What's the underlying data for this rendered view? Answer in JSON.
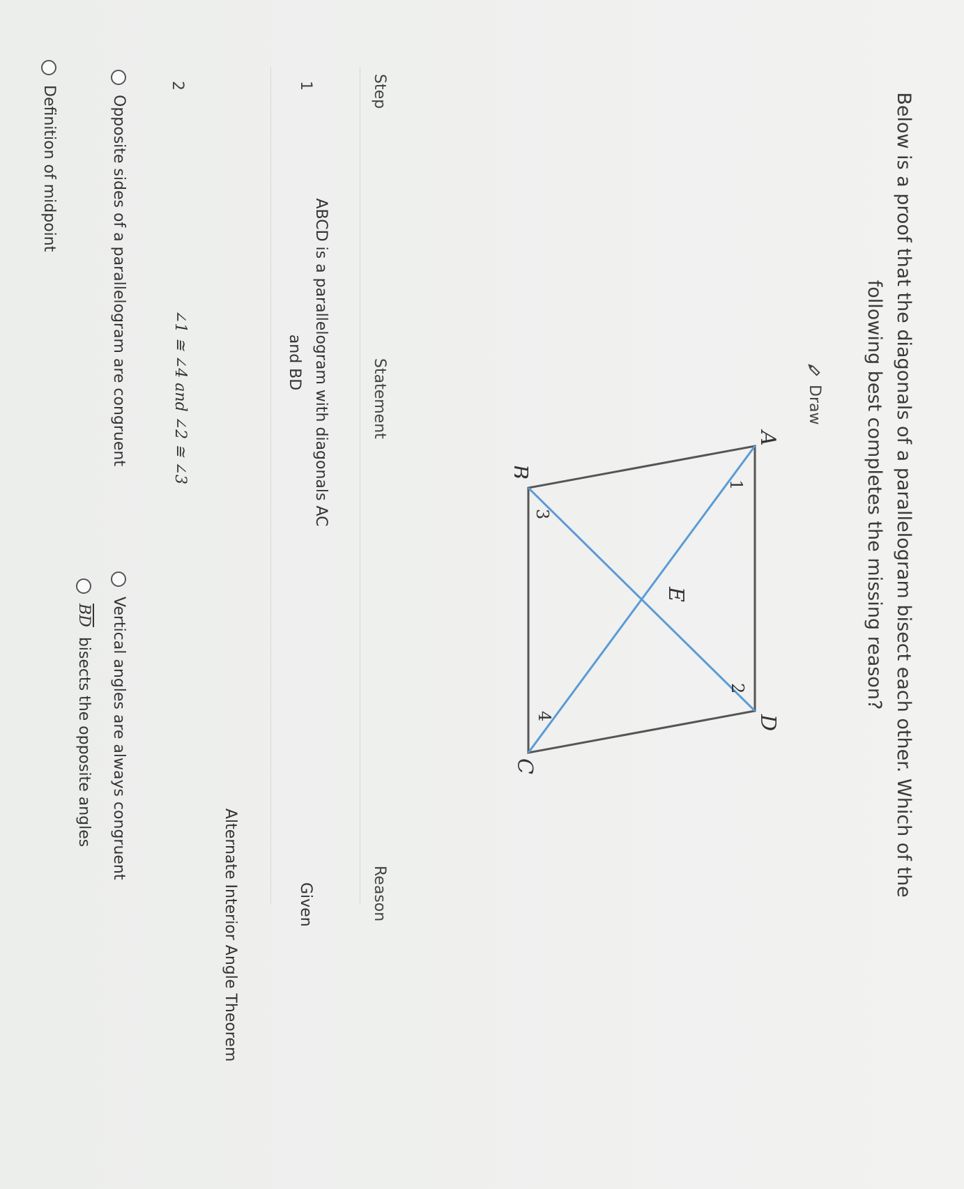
{
  "question": "Below is a proof that the diagonals of a parallelogram bisect each other. Which of the following best completes the missing reason?",
  "draw_label": "Draw",
  "figure": {
    "points": {
      "A": "A",
      "B": "B",
      "C": "C",
      "D": "D",
      "E": "E"
    },
    "angles": {
      "a1": "1",
      "a2": "2",
      "a3": "3",
      "a4": "4"
    },
    "side_color": "#555555",
    "diagonal_color": "#5b9bd5"
  },
  "table": {
    "headers": {
      "step": "Step",
      "statement": "Statement",
      "reason": "Reason"
    },
    "rows": [
      {
        "step": "1",
        "statement_line1": "ABCD is a parallelogram with diagonals AC",
        "statement_line2": "and BD",
        "reason": "Given"
      },
      {
        "step": "2",
        "statement": "∠1 ≅ ∠4 and ∠2 ≅ ∠3",
        "reason": "Alternate Interior Angle Theorem"
      }
    ]
  },
  "options": [
    {
      "rest": "bisects the opposite angles",
      "label_math": "BD"
    },
    {
      "text": "Vertical angles are always congruent"
    },
    {
      "text": "Opposite sides of a parallelogram are congruent"
    },
    {
      "text": "Definition of midpoint"
    }
  ]
}
